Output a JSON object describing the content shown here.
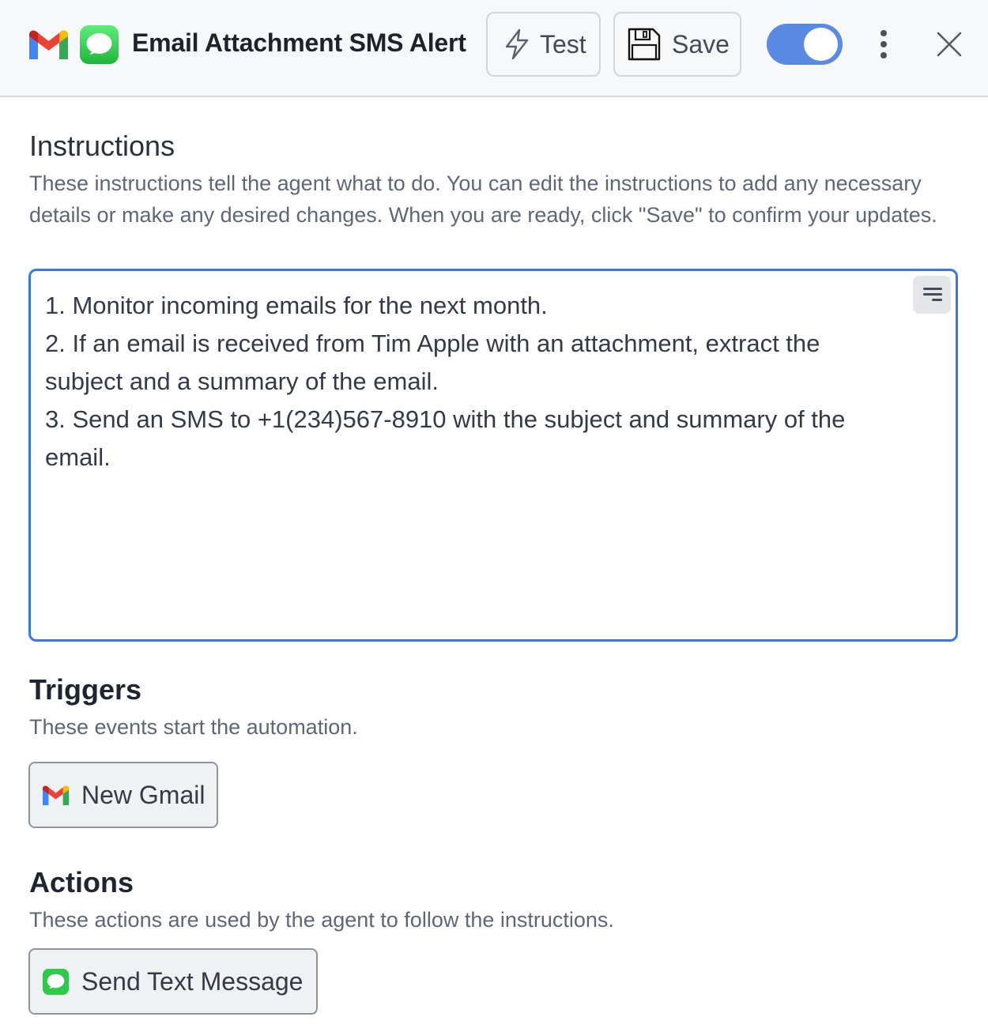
{
  "header": {
    "title": "Email Attachment SMS Alert",
    "app_icons": [
      "gmail-icon",
      "messages-icon"
    ],
    "test_label": "Test",
    "save_label": "Save",
    "toggle_on": true,
    "accent_color": "#5b8ae3"
  },
  "instructions": {
    "title": "Instructions",
    "description": "These instructions tell the agent what to do. You can edit the instructions to add any necessary details or make any desired changes. When you are ready, click \"Save\" to confirm your updates.",
    "lines": [
      "1. Monitor incoming emails for the next month.",
      "2. If an email is received from Tim Apple with an attachment, extract the subject and a summary of the email.",
      "3. Send an SMS to +1(234)567-8910 with the subject and summary of the email."
    ]
  },
  "triggers": {
    "title": "Triggers",
    "description": "These events start the automation.",
    "items": [
      {
        "label": "New Gmail",
        "icon": "gmail-icon"
      }
    ]
  },
  "actions": {
    "title": "Actions",
    "description": "These actions are used by the agent to follow the instructions.",
    "items": [
      {
        "label": "Send Text Message",
        "icon": "messages-icon"
      }
    ]
  }
}
